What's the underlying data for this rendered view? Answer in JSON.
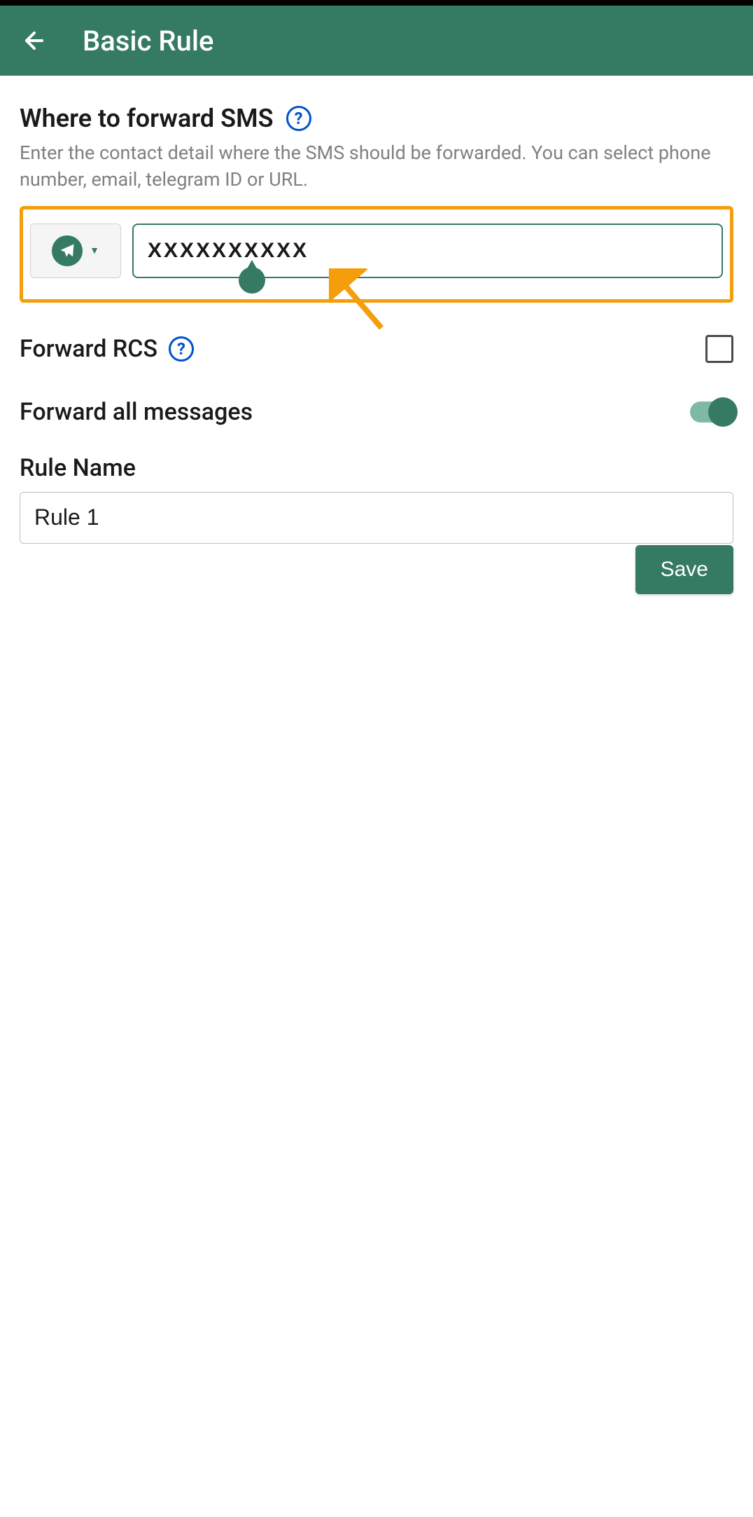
{
  "header": {
    "title": "Basic Rule"
  },
  "forward_section": {
    "title": "Where to forward SMS",
    "subtitle": "Enter the contact detail where the SMS should be forwarded. You can select phone number, email, telegram ID or URL.",
    "contact_type": "telegram",
    "contact_value": "XXXXXXXXXX"
  },
  "forward_rcs": {
    "label": "Forward RCS",
    "checked": false
  },
  "forward_all": {
    "label": "Forward all messages",
    "enabled": true
  },
  "rule_name": {
    "label": "Rule Name",
    "value": "Rule 1"
  },
  "save_button": {
    "label": "Save"
  }
}
